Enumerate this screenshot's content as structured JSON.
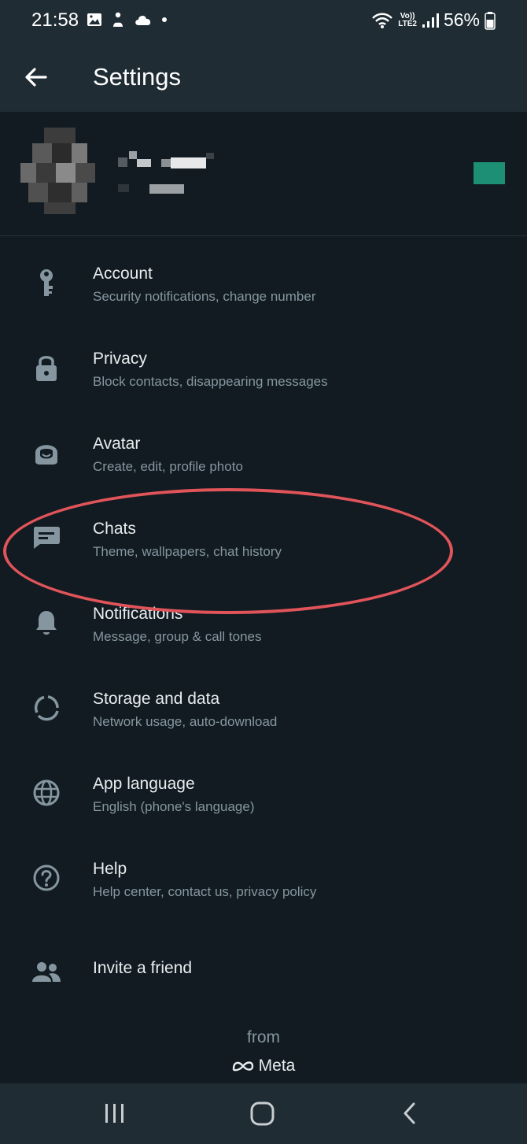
{
  "status_bar": {
    "time": "21:58",
    "battery": "56%",
    "network_label_top": "Vo))",
    "network_label_bottom": "LTE2",
    "left_icons": [
      "gallery-icon",
      "app-notification-icon",
      "cloud-icon",
      "dot-icon"
    ],
    "right_icons": [
      "wifi-icon",
      "signal-icon",
      "battery-icon"
    ]
  },
  "app_bar": {
    "title": "Settings",
    "back_icon": "arrow-left-icon"
  },
  "profile": {
    "name": "",
    "about": "",
    "accent_color": "#1c8f74"
  },
  "menu": {
    "items": [
      {
        "label": "Account",
        "sub": "Security notifications, change number",
        "icon": "key-icon"
      },
      {
        "label": "Privacy",
        "sub": "Block contacts, disappearing messages",
        "icon": "lock-icon"
      },
      {
        "label": "Avatar",
        "sub": "Create, edit, profile photo",
        "icon": "avatar-face-icon"
      },
      {
        "label": "Chats",
        "sub": "Theme, wallpapers, chat history",
        "icon": "chat-icon"
      },
      {
        "label": "Notifications",
        "sub": "Message, group & call tones",
        "icon": "bell-icon"
      },
      {
        "label": "Storage and data",
        "sub": "Network usage, auto-download",
        "icon": "data-usage-icon"
      },
      {
        "label": "App language",
        "sub": "English (phone's language)",
        "icon": "globe-icon"
      },
      {
        "label": "Help",
        "sub": "Help center, contact us, privacy policy",
        "icon": "help-icon"
      },
      {
        "label": "Invite a friend",
        "sub": "",
        "icon": "people-icon"
      }
    ]
  },
  "footer": {
    "from": "from",
    "brand": "Meta"
  },
  "colors": {
    "background": "#111b21",
    "bar": "#1f2c34",
    "primary_text": "#e9edef",
    "secondary_text": "#8696a0",
    "highlight": "#e0545a"
  }
}
